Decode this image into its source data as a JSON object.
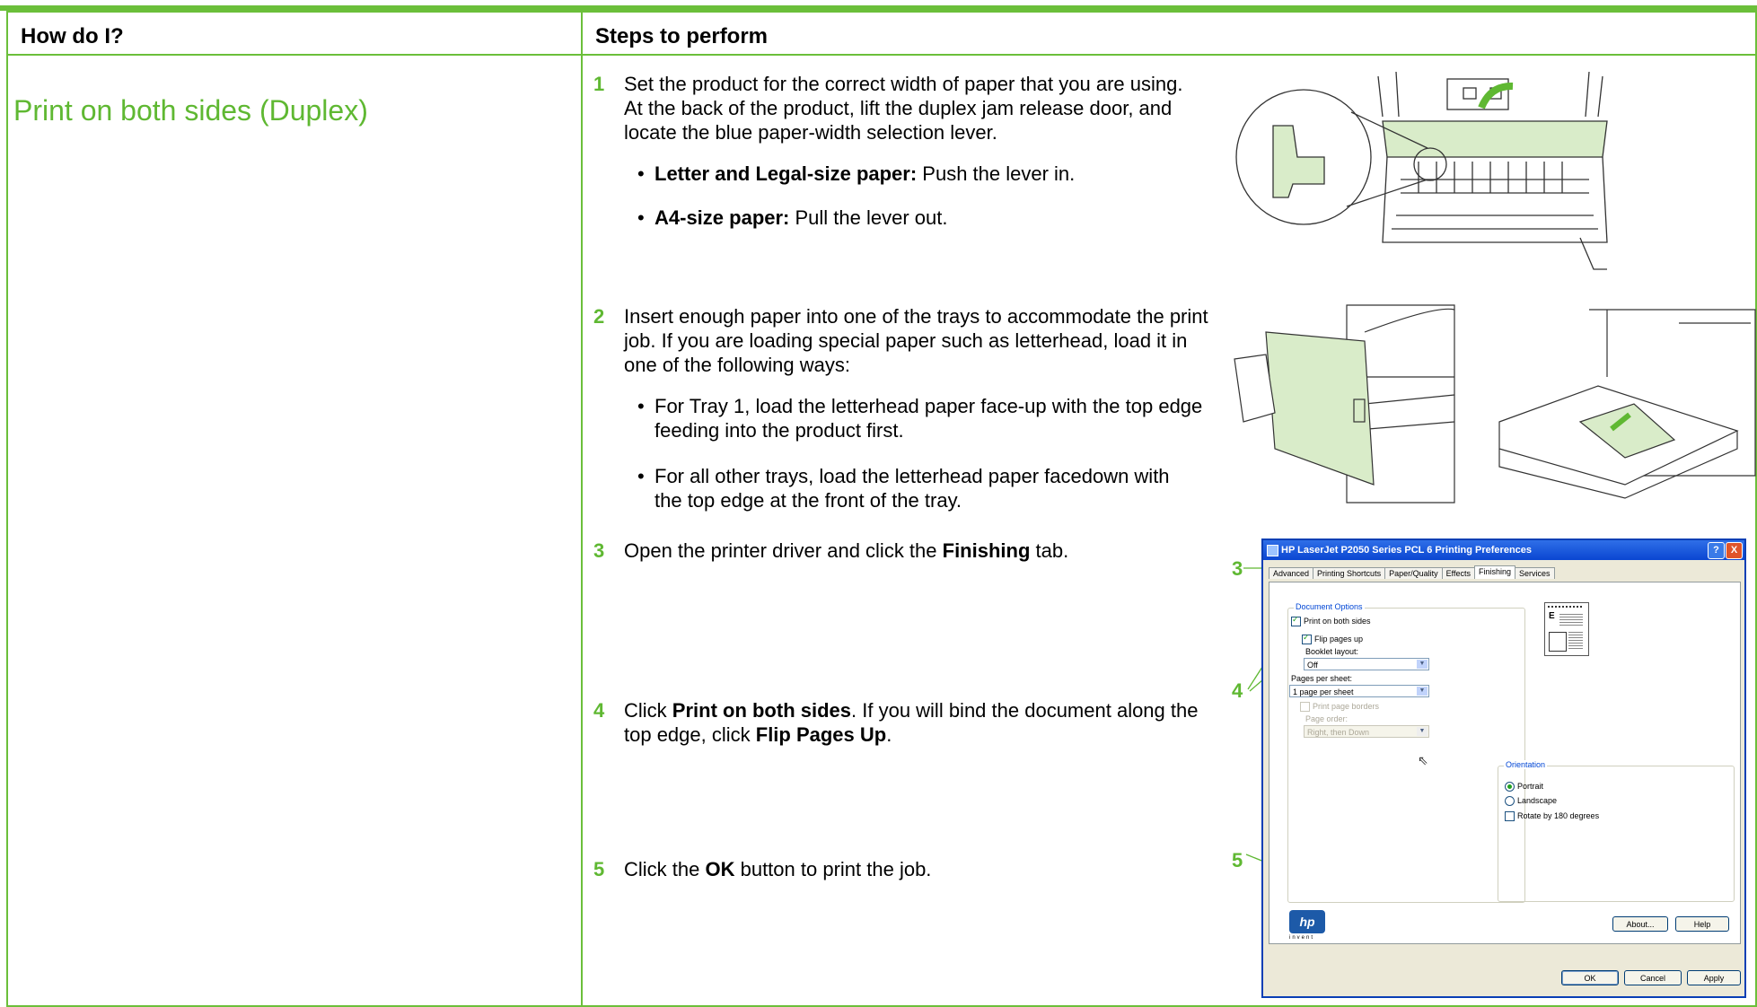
{
  "header": {
    "col1": "How do I?",
    "col2": "Steps to perform"
  },
  "task": "Print on both sides (Duplex)",
  "steps": [
    {
      "num": "1",
      "text": "Set the product for the correct width of paper that you are using. At the back of the product, lift the duplex jam release door, and locate the blue paper-width selection lever."
    },
    {
      "num": "2",
      "text": "Insert enough paper into one of the trays to accommodate the print job. If you are loading special paper such as letterhead, load it in one of the following ways:"
    },
    {
      "num": "3",
      "pre": "Open the printer driver and click the ",
      "bold": "Finishing",
      "post": " tab."
    },
    {
      "num": "4",
      "pre": "Click ",
      "bold": "Print on both sides",
      "mid": ". If you will bind the document along the top edge, click ",
      "bold2": "Flip Pages Up",
      "post": "."
    },
    {
      "num": "5",
      "pre": "Click the ",
      "bold": "OK",
      "post": " button to print the job."
    }
  ],
  "bullets1": [
    {
      "bold": "Letter and Legal-size paper:",
      "text": " Push the lever in."
    },
    {
      "bold": "A4-size paper:",
      "text": " Pull the lever out."
    }
  ],
  "bullets2": [
    {
      "text": "For Tray 1, load the letterhead paper face-up with the top edge feeding into the product first."
    },
    {
      "text": "For all other trays, load the letterhead paper facedown with the top edge at the front of the tray."
    }
  ],
  "callouts": {
    "c3": "3",
    "c4": "4",
    "c5": "5"
  },
  "dialog": {
    "title": "HP LaserJet P2050 Series PCL 6 Printing Preferences",
    "help": "?",
    "close": "X",
    "tabs": [
      "Advanced",
      "Printing Shortcuts",
      "Paper/Quality",
      "Effects",
      "Finishing",
      "Services"
    ],
    "doc_options": "Document Options",
    "print_both_sides": "Print on both sides",
    "flip_pages_up": "Flip pages up",
    "booklet_layout": "Booklet layout:",
    "booklet_value": "Off",
    "pages_per_sheet": "Pages per sheet:",
    "pages_value": "1 page per sheet",
    "print_page_borders": "Print page borders",
    "page_order": "Page order:",
    "page_order_value": "Right, then Down",
    "orientation": "Orientation",
    "portrait": "Portrait",
    "landscape": "Landscape",
    "rotate": "Rotate by 180 degrees",
    "logo": "hp",
    "logo_sub": "invent",
    "about": "About...",
    "help_btn": "Help",
    "ok": "OK",
    "cancel": "Cancel",
    "apply": "Apply"
  },
  "colors": {
    "accent": "#6bbf3a",
    "text_green": "#5fb832"
  }
}
